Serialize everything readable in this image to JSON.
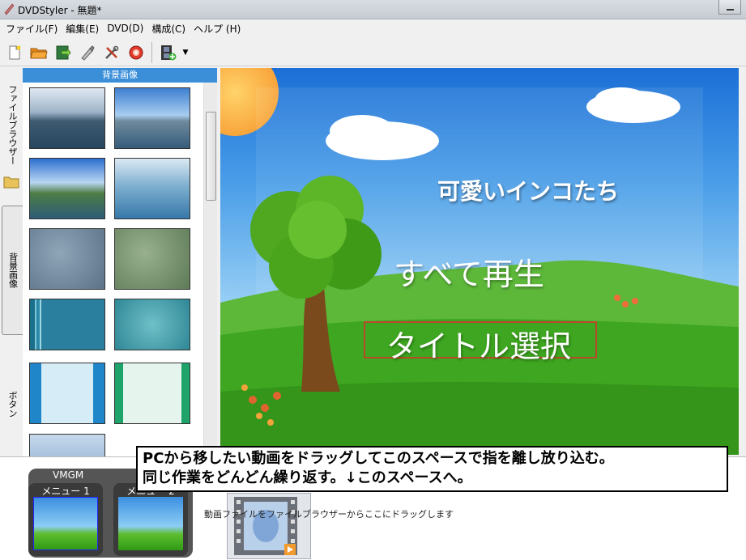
{
  "window": {
    "title": "DVDStyler - 無題*"
  },
  "menubar": {
    "items": [
      "ファイル(F)",
      "編集(E)",
      "DVD(D)",
      "構成(C)",
      "ヘルプ (H)"
    ]
  },
  "toolbar": {
    "buttons": [
      "new-icon",
      "open-folder-icon",
      "save-icon",
      "burn-icon",
      "settings-icon",
      "dvd-icon",
      "add-video-icon",
      "dropdown-arrow-icon"
    ]
  },
  "side_tabs": {
    "file_browser": "ファイルブラウザー",
    "backgrounds": "背景画像",
    "buttons": "ボタン"
  },
  "background_panel": {
    "header": "背景画像"
  },
  "canvas": {
    "menu_title": "可愛いインコたち",
    "play_all": "すべて再生",
    "title_select": "タイトル選択"
  },
  "callout": {
    "line1": "PCから移したい動画をドラッグしてこのスペースで指を離し放り込む。",
    "line2": "同じ作業をどんどん繰り返す。↓このスペースへ。"
  },
  "titleset": {
    "vmgm_label": "VMGM",
    "menu1_label": "メニュー 1",
    "menu2_label": "メニュー 2",
    "drop_hint": "動画ファイルをファイルブラウザーからここにドラッグします"
  },
  "colors": {
    "header_blue": "#3b8fd9",
    "selection_border": "#b84a2a"
  }
}
